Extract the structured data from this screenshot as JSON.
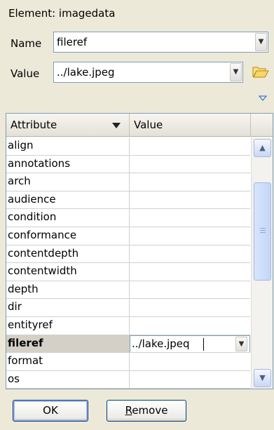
{
  "dialog": {
    "element_label": "Element: imagedata",
    "name_label": "Name",
    "name_value": "fileref",
    "value_label": "Value",
    "value_value": "../lake.jpeg"
  },
  "table": {
    "col_attribute": "Attribute",
    "col_value": "Value",
    "rows": [
      {
        "attr": "align",
        "value": ""
      },
      {
        "attr": "annotations",
        "value": ""
      },
      {
        "attr": "arch",
        "value": ""
      },
      {
        "attr": "audience",
        "value": ""
      },
      {
        "attr": "condition",
        "value": ""
      },
      {
        "attr": "conformance",
        "value": ""
      },
      {
        "attr": "contentdepth",
        "value": ""
      },
      {
        "attr": "contentwidth",
        "value": ""
      },
      {
        "attr": "depth",
        "value": ""
      },
      {
        "attr": "dir",
        "value": ""
      },
      {
        "attr": "entityref",
        "value": ""
      },
      {
        "attr": "fileref",
        "value": "../lake.jpeq"
      },
      {
        "attr": "format",
        "value": ""
      },
      {
        "attr": "os",
        "value": ""
      }
    ],
    "selected_row": 11
  },
  "buttons": {
    "ok": "OK",
    "remove_prefix": "R",
    "remove_rest": "emove"
  },
  "icons": {
    "combo_arrow": "chevron-down-icon",
    "open": "folder-open-icon",
    "expand": "triangle-down-icon",
    "sort": "sort-desc-icon",
    "scroll_up": "chevron-up-icon",
    "scroll_down": "chevron-down-icon"
  }
}
